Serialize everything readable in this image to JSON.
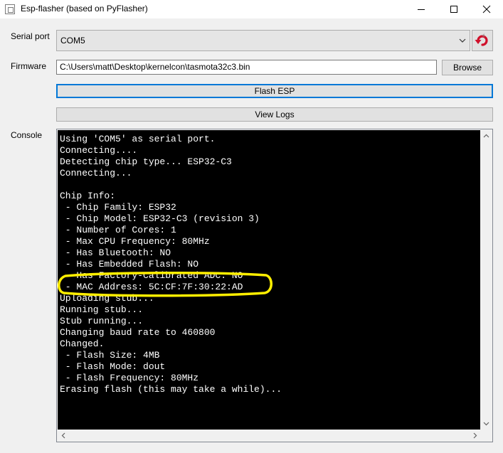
{
  "window": {
    "title": "Esp-flasher (based on PyFlasher)"
  },
  "serial_port": {
    "label": "Serial port",
    "value": "COM5"
  },
  "firmware": {
    "label": "Firmware",
    "value": "C:\\Users\\matt\\Desktop\\kernelcon\\tasmota32c3.bin",
    "browse_label": "Browse"
  },
  "actions": {
    "flash_label": "Flash ESP",
    "view_logs_label": "View Logs"
  },
  "console": {
    "label": "Console",
    "lines": [
      "Using 'COM5' as serial port.",
      "Connecting....",
      "Detecting chip type... ESP32-C3",
      "Connecting...",
      "",
      "Chip Info:",
      " - Chip Family: ESP32",
      " - Chip Model: ESP32-C3 (revision 3)",
      " - Number of Cores: 1",
      " - Max CPU Frequency: 80MHz",
      " - Has Bluetooth: NO",
      " - Has Embedded Flash: NO",
      " - Has Factory-Calibrated ADC: NO",
      " - MAC Address: 5C:CF:7F:30:22:AD",
      "Uploading stub...",
      "Running stub...",
      "Stub running...",
      "Changing baud rate to 460800",
      "Changed.",
      " - Flash Size: 4MB",
      " - Flash Mode: dout",
      " - Flash Frequency: 80MHz",
      "Erasing flash (this may take a while)..."
    ]
  },
  "colors": {
    "highlight": "#ffee00",
    "accent": "#0078d7",
    "reload_icon": "#d0102a"
  },
  "icons": {
    "app": "app-icon",
    "minimize": "minimize-icon",
    "maximize": "maximize-icon",
    "close": "close-icon",
    "reload": "reload-icon",
    "dropdown": "chevron-down-icon"
  }
}
